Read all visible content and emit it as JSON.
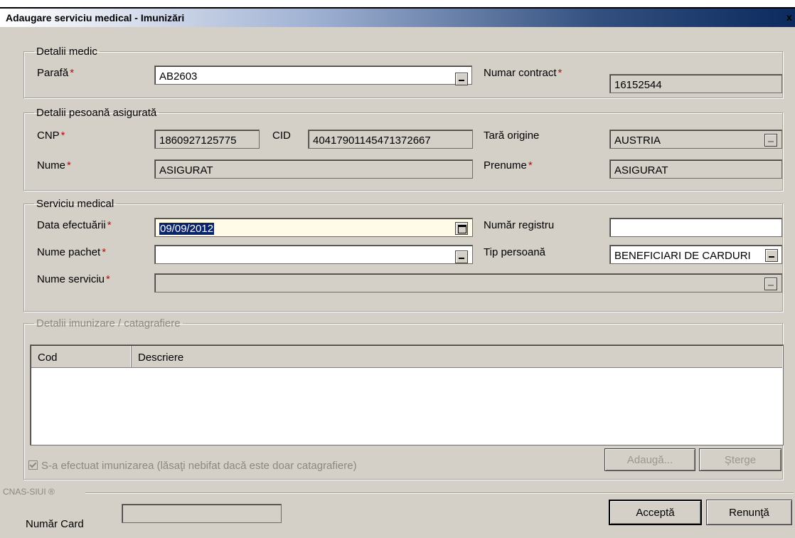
{
  "window": {
    "title": "Adaugare serviciu medical - Imunizări",
    "close_glyph": "x"
  },
  "medic": {
    "legend": "Detalii medic",
    "parafa_label": "Parafă",
    "parafa_value": "AB2603",
    "contract_label": "Numar contract",
    "contract_value": "16152544"
  },
  "insured": {
    "legend": "Detalii pesoană asigurată",
    "cnp_label": "CNP",
    "cnp_value": "1860927125775",
    "cid_label": "CID",
    "cid_value": "40417901145471372667",
    "country_label": "Tară origine",
    "country_value": "AUSTRIA",
    "name_label": "Nume",
    "name_value": "ASIGURAT",
    "firstname_label": "Prenume",
    "firstname_value": "ASIGURAT"
  },
  "service": {
    "legend": "Serviciu medical",
    "date_label": "Data efectuării",
    "date_value": "09/09/2012",
    "registry_label": "Număr registru",
    "registry_value": "",
    "package_label": "Nume pachet",
    "package_value": "",
    "person_type_label": "Tip persoană",
    "person_type_value": "BENEFICIARI DE CARDURI",
    "service_name_label": "Nume serviciu",
    "service_name_value": ""
  },
  "immunization": {
    "legend": "Detalii imunizare / catagrafiere",
    "columns": [
      "Cod",
      "Descriere"
    ],
    "rows": [],
    "checkbox_label": "S-a efectuat imunizarea (lăsaţi nebifat dacă este doar catagrafiere)",
    "checkbox_checked": true,
    "add_label": "Adaugă...",
    "delete_label": "Şterge"
  },
  "footer": {
    "brand": "CNAS-SIUI ®",
    "card_label": "Număr Card",
    "card_value": "",
    "accept_label": "Acceptă",
    "cancel_label": "Renunţă"
  },
  "required_marker": "*",
  "colors": {
    "required": "#d00000",
    "selection": "#0a246a",
    "window_bg": "#d4d0c8"
  },
  "icons": {
    "lookup": "ellipsis-button-icon",
    "calendar": "calendar-icon",
    "close": "close-icon",
    "check": "check-icon"
  }
}
